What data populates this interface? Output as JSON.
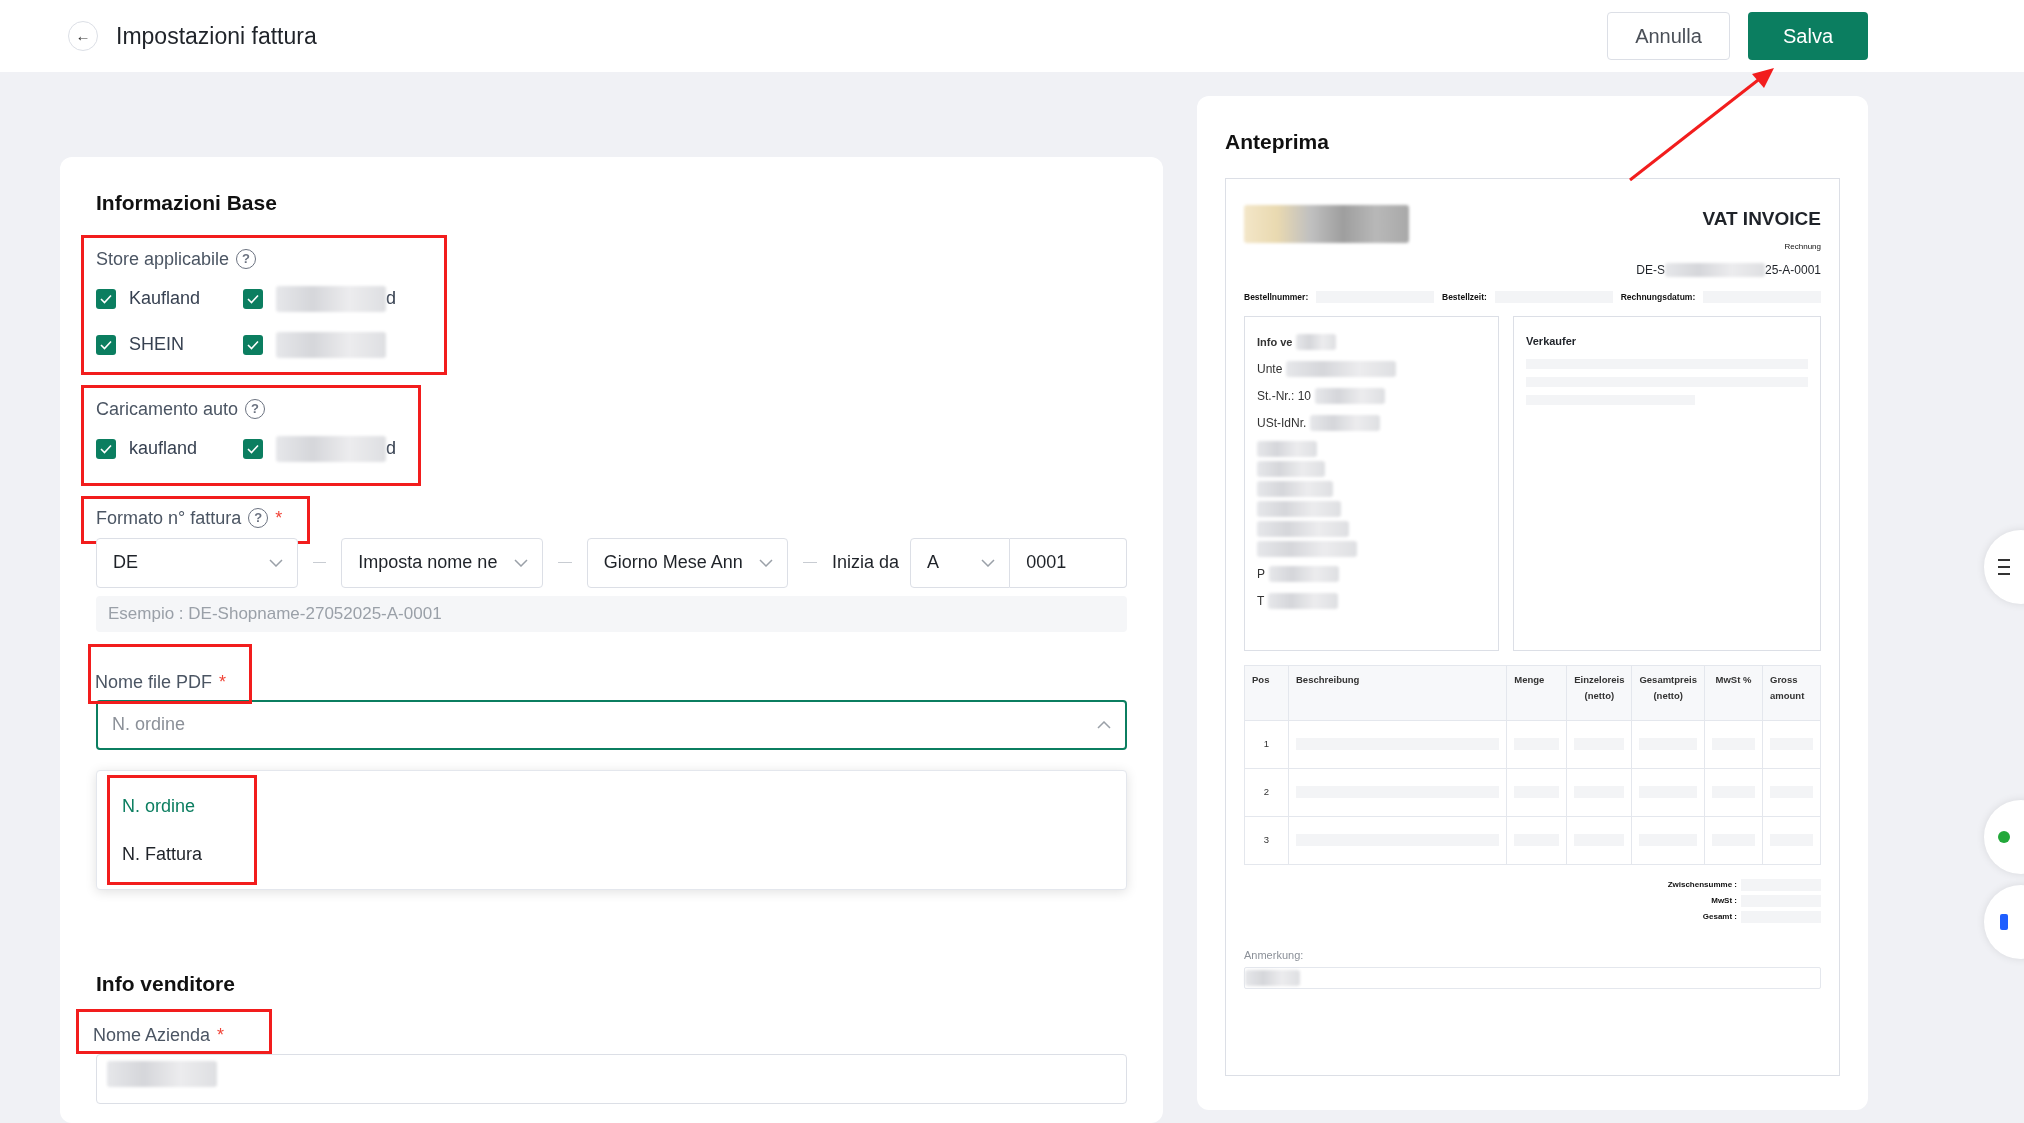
{
  "header": {
    "back_icon": "←",
    "title": "Impostazioni fattura",
    "buttons": [
      {
        "label": "Annulla",
        "kind": "secondary"
      },
      {
        "label": "Salva",
        "kind": "primary"
      }
    ]
  },
  "form": {
    "section_title": "Informazioni Base",
    "stores": {
      "label": "Store applicabile",
      "help": "?",
      "annotated": true,
      "options": [
        {
          "label": "Kaufland",
          "checked": true,
          "redacted": false
        },
        {
          "label": "d",
          "checked": true,
          "redacted": true
        },
        {
          "label": "SHEIN",
          "checked": true,
          "redacted": false
        },
        {
          "checked": true,
          "redacted": true
        }
      ]
    },
    "auto_upload": {
      "label": "Caricamento auto",
      "help": "?",
      "annotated": true,
      "options": [
        {
          "label": "kaufland",
          "checked": true,
          "redacted": false
        },
        {
          "label": "d",
          "checked": true,
          "redacted": true
        }
      ]
    },
    "invoice_format": {
      "label": "Formato n° fattura",
      "help": "?",
      "required_mark": "*",
      "annotated": true,
      "selects": [
        "DE",
        "Imposta nome ne",
        "Giorno Mese Ann"
      ],
      "start_label": "Inizia da",
      "letter": "A",
      "number": "0001",
      "example": "Esempio : DE-Shopname-27052025-A-0001"
    },
    "pdf_name": {
      "label": "Nome file PDF",
      "required_mark": "*",
      "annotated": true,
      "value": "N. ordine",
      "expanded": true,
      "options_annotated": true,
      "options": [
        {
          "label": "N. ordine",
          "selected": true
        },
        {
          "label": "N. Fattura",
          "selected": false
        }
      ]
    },
    "seller_title": "Info venditore",
    "company": {
      "label": "Nome Azienda",
      "required_mark": "*",
      "annotated": true,
      "redacted": true
    }
  },
  "preview": {
    "title": "Anteprima",
    "invoice": {
      "title": "VAT INVOICE",
      "subtitle": "Rechnung",
      "number_start": "DE-S",
      "number_end": "25-A-0001",
      "meta": [
        "Bestellnummer:",
        "Bestellzeit:",
        "Rechnungsdatum:"
      ],
      "buyer": {
        "heading": "Info ve",
        "lines": [
          "Unte",
          "St.-Nr.: 10",
          "USt-IdNr.",
          "P",
          "T"
        ]
      },
      "seller": {
        "heading": "Verkaufer"
      },
      "columns": [
        "Pos",
        "Beschreibung",
        "Menge",
        "Einzeloreis (netto)",
        "Gesamtpreis (netto)",
        "MwSt %",
        "Gross amount"
      ],
      "rows": [
        "1",
        "2",
        "3"
      ],
      "totals": [
        "Zwischensumme :",
        "MwSt :",
        "Gesamt :"
      ],
      "note_label": "Anmerkung:"
    }
  },
  "annotation_arrow": true
}
